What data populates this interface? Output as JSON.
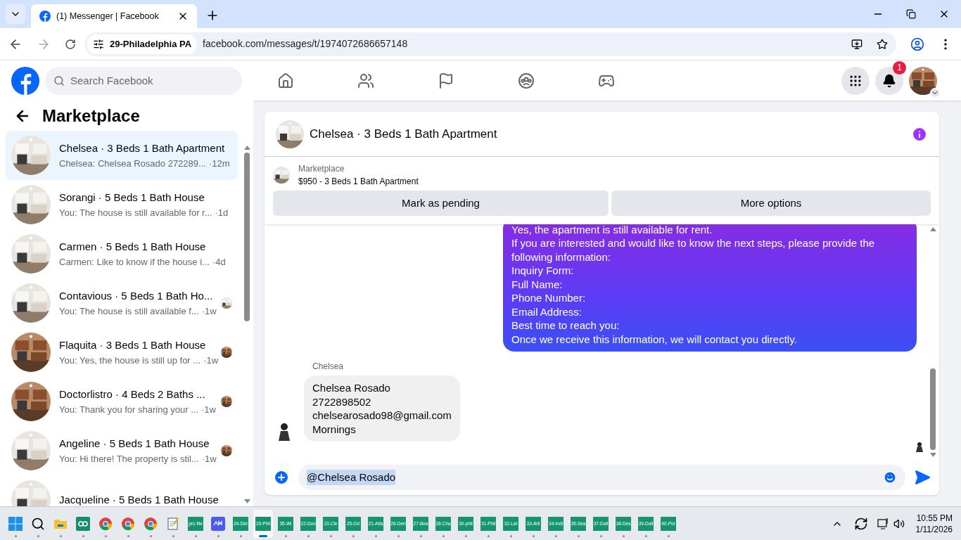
{
  "browser": {
    "tabs": [
      {
        "title": "(1) Messenger | Facebook",
        "selected": true
      }
    ],
    "site_chip": "29-Philadelphia PA",
    "url": "facebook.com/messages/t/1974072686657148"
  },
  "facebook": {
    "search_placeholder": "Search Facebook",
    "notification_count": "1"
  },
  "sidebar": {
    "title": "Marketplace",
    "conversations": [
      {
        "name": "Chelsea · 3 Beds 1 Bath Apartment",
        "preview": "Chelsea: Chelsea Rosado 272289...",
        "time": "·12m",
        "selected": true,
        "seen_avatar": false
      },
      {
        "name": "Sorangi · 5 Beds 1 Bath House",
        "preview": "You: The house is still available for r...",
        "time": "·1d",
        "selected": false,
        "seen_avatar": false
      },
      {
        "name": "Carmen · 5 Beds 1 Bath House",
        "preview": "Carmen: Like to know if the house i...",
        "time": "·4d",
        "selected": false,
        "seen_avatar": false
      },
      {
        "name": "Contavious · 5 Beds 1 Bath Ho...",
        "preview": "You: The house is still available f...",
        "time": "·1w",
        "selected": false,
        "seen_avatar": true
      },
      {
        "name": "Flaquita · 3 Beds 1 Bath House",
        "preview": "You: Yes, the house is still up for ...",
        "time": "·1w",
        "selected": false,
        "seen_avatar": true
      },
      {
        "name": "Doctorlistro · 4 Beds 2 Baths ...",
        "preview": "You: Thank you for sharing your ...",
        "time": "·1w",
        "selected": false,
        "seen_avatar": true
      },
      {
        "name": "Angeline · 5 Beds 1 Bath House",
        "preview": "You: Hi there! The property is stil...",
        "time": "·1w",
        "selected": false,
        "seen_avatar": true
      },
      {
        "name": "Jacqueline · 5 Beds 1 Bath House",
        "selected": false,
        "seen_avatar": false
      }
    ]
  },
  "chat": {
    "title": "Chelsea · 3 Beds 1 Bath Apartment",
    "listing": {
      "label": "Marketplace",
      "title": "$950 - 3 Beds 1 Bath Apartment"
    },
    "buttons": [
      "Mark as pending",
      "More options"
    ],
    "messages": [
      {
        "kind": "outgoing",
        "lines": [
          "Yes, the apartment is still available for rent.",
          "If you are interested and would like to know the next steps, please provide the following information:",
          "Inquiry Form:",
          "Full Name:",
          "Phone Number:",
          "Email Address:",
          "Best time to reach you:",
          "Once we receive this information, we will contact you directly."
        ]
      },
      {
        "kind": "incoming",
        "sender": "Chelsea",
        "lines": [
          "Chelsea Rosado",
          "2722898502",
          "chelsearosado98@gmail.com",
          "Mornings"
        ]
      }
    ],
    "composer": {
      "value": "@Chelsea Rosado"
    }
  },
  "taskbar": {
    "apps": [
      {
        "kind": "start",
        "selected": false
      },
      {
        "kind": "search",
        "selected": false
      },
      {
        "kind": "folder",
        "selected": false
      },
      {
        "kind": "qo",
        "selected": false
      },
      {
        "kind": "chrome",
        "selected": false
      },
      {
        "kind": "chrome",
        "selected": false
      },
      {
        "kind": "chrome",
        "selected": false
      },
      {
        "kind": "notepad",
        "selected": false
      },
      {
        "kind": "tile",
        "label": "pro file",
        "selected": false
      },
      {
        "kind": "amc",
        "selected": false
      },
      {
        "kind": "tile",
        "label": "24-Det",
        "selected": false
      },
      {
        "kind": "tile",
        "label": "29-Phil",
        "selected": true
      },
      {
        "kind": "tile",
        "label": "35-Wi",
        "selected": false
      },
      {
        "kind": "tile",
        "label": "22-Dov",
        "selected": false
      },
      {
        "kind": "tile",
        "label": "23-Cle",
        "selected": false
      },
      {
        "kind": "tile",
        "label": "25-Orl",
        "selected": false
      },
      {
        "kind": "tile",
        "label": "21-Atla",
        "selected": false
      },
      {
        "kind": "tile",
        "label": "26-Den",
        "selected": false
      },
      {
        "kind": "tile",
        "label": "27-Bea",
        "selected": false
      },
      {
        "kind": "tile",
        "label": "28-Cha",
        "selected": false
      },
      {
        "kind": "tile",
        "label": "30-phil",
        "selected": false
      },
      {
        "kind": "tile",
        "label": "31-Phil",
        "selected": false
      },
      {
        "kind": "tile",
        "label": "32-Lat",
        "selected": false
      },
      {
        "kind": "tile",
        "label": "33-Arli",
        "selected": false
      },
      {
        "kind": "tile",
        "label": "34-Indi",
        "selected": false
      },
      {
        "kind": "tile",
        "label": "36-Sea",
        "selected": false
      },
      {
        "kind": "tile",
        "label": "37-Dall",
        "selected": false
      },
      {
        "kind": "tile",
        "label": "38-Des",
        "selected": false
      },
      {
        "kind": "tile",
        "label": "39-Dall",
        "selected": false
      },
      {
        "kind": "tile",
        "label": "40-Por",
        "selected": false
      }
    ],
    "time": "10:55 PM",
    "date": "1/11/2026"
  }
}
